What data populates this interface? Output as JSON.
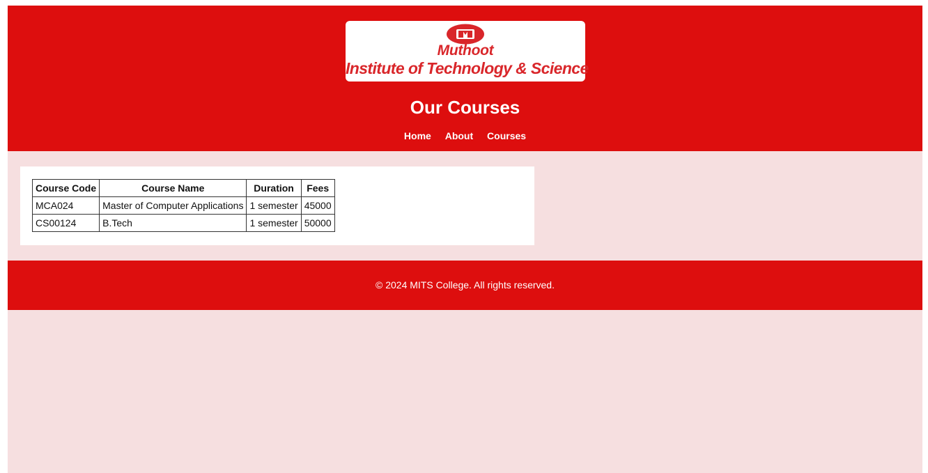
{
  "colors": {
    "header_bg": "#dd0e0e",
    "page_bg": "#f6dfe0",
    "card_bg": "#ffffff",
    "logo_red": "#d9262a"
  },
  "logo": {
    "emblem_icon": "mits-emblem-icon",
    "line1": "Muthoot",
    "line2": "Institute of Technology & Science"
  },
  "header": {
    "title": "Our Courses"
  },
  "nav": {
    "items": [
      {
        "label": "Home"
      },
      {
        "label": "About"
      },
      {
        "label": "Courses"
      }
    ]
  },
  "courses_table": {
    "headers": [
      "Course Code",
      "Course Name",
      "Duration",
      "Fees"
    ],
    "rows": [
      [
        "MCA024",
        "Master of Computer Applications",
        "1 semester",
        "45000"
      ],
      [
        "CS00124",
        "B.Tech",
        "1 semester",
        "50000"
      ]
    ]
  },
  "footer": {
    "text": "© 2024 MITS College. All rights reserved."
  }
}
